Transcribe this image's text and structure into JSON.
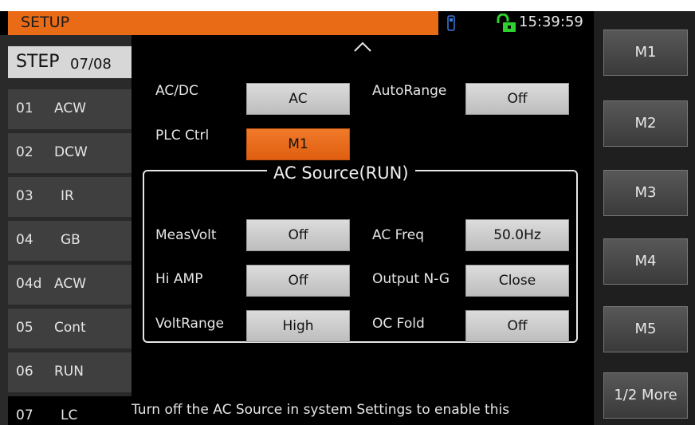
{
  "header": {
    "title": "SETUP",
    "time": "15:39:59",
    "icons": {
      "usb": "usb-icon",
      "lock": "unlock-icon"
    },
    "accent_color": "#ea6b16"
  },
  "sidebar": {
    "step_label": "STEP",
    "step_count": "07/08",
    "items": [
      {
        "num": "01",
        "name": "ACW"
      },
      {
        "num": "02",
        "name": "DCW"
      },
      {
        "num": "03",
        "name": "IR"
      },
      {
        "num": "04",
        "name": "GB"
      },
      {
        "num": "04d",
        "name": "ACW"
      },
      {
        "num": "05",
        "name": "Cont"
      },
      {
        "num": "06",
        "name": "RUN"
      },
      {
        "num": "07",
        "name": "LC"
      }
    ]
  },
  "main": {
    "acdc": {
      "label": "AC/DC",
      "value": "AC"
    },
    "autorange": {
      "label": "AutoRange",
      "value": "Off"
    },
    "plc": {
      "label": "PLC Ctrl",
      "value": "M1"
    },
    "source_title": "AC Source(RUN)",
    "measvolt": {
      "label": "MeasVolt",
      "value": "Off"
    },
    "acfreq": {
      "label": "AC Freq",
      "value": "50.0Hz"
    },
    "hiamp": {
      "label": "Hi AMP",
      "value": "Off"
    },
    "outputng": {
      "label": "Output N-G",
      "value": "Close"
    },
    "voltrange": {
      "label": "VoltRange",
      "value": "High"
    },
    "ocfold": {
      "label": "OC Fold",
      "value": "Off"
    },
    "status": "Turn off the AC Source in system Settings to enable this"
  },
  "softkeys": [
    "M1",
    "M2",
    "M3",
    "M4",
    "M5",
    "1/2 More"
  ]
}
